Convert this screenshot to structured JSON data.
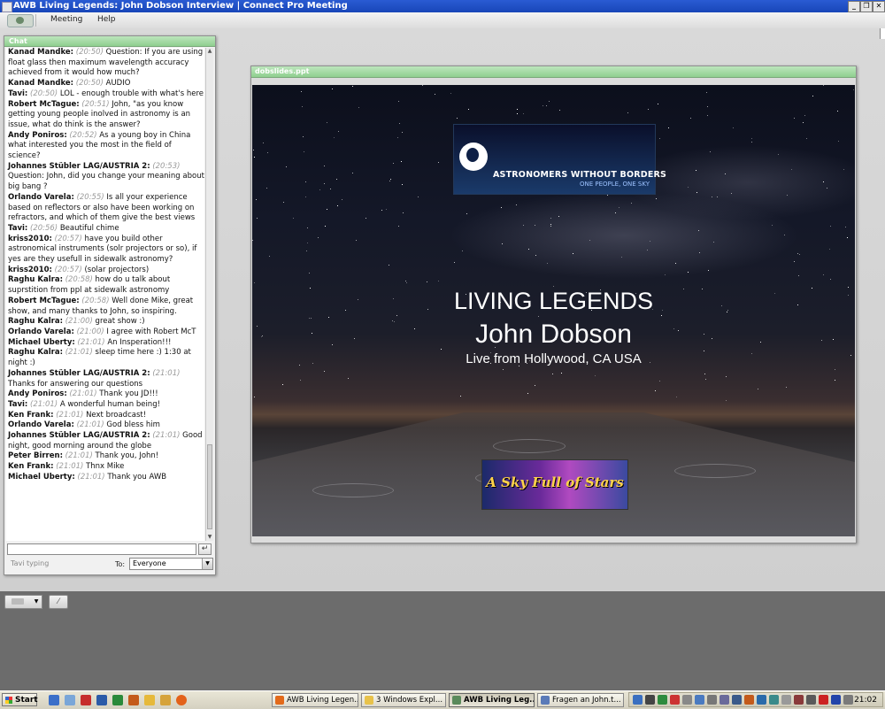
{
  "window": {
    "title": "AWB Living Legends: John Dobson Interview | Connect Pro Meeting",
    "controls": [
      "_",
      "❐",
      "✕"
    ]
  },
  "menu": {
    "items": [
      "Meeting",
      "Help"
    ]
  },
  "chat": {
    "pod_title": "Chat",
    "messages": [
      {
        "name": "Kanad Mandke:",
        "time": "(20:50)",
        "text": "Question: If you are using float glass then maximum wavelength accuracy achieved from it would how much?"
      },
      {
        "name": "Kanad Mandke:",
        "time": "(20:50)",
        "text": "AUDIO"
      },
      {
        "name": "Tavi:",
        "time": "(20:50)",
        "text": "LOL - enough trouble with what's here"
      },
      {
        "name": "Robert McTague:",
        "time": "(20:51)",
        "text": "John, \"as you know getting young people inolved in astronomy is an issue,  what do think is the answer?"
      },
      {
        "name": "Andy Poniros:",
        "time": "(20:52)",
        "text": "As a young boy in China what interested you the most in the field of science?"
      },
      {
        "name": "Johannes Stübler LAG/AUSTRIA 2:",
        "time": "(20:53)",
        "text": "Question: John, did you change your meaning about big bang ?"
      },
      {
        "name": "Orlando Varela:",
        "time": "(20:55)",
        "text": "Is all your experience based on reflectors or  also have been working on refractors, and which of them give the best views"
      },
      {
        "name": "Tavi:",
        "time": "(20:56)",
        "text": "Beautiful chime"
      },
      {
        "name": "kriss2010:",
        "time": "(20:57)",
        "text": "have you build other astronomical instruments (solr projectors or so), if yes are they usefull in sidewalk astronomy?"
      },
      {
        "name": "kriss2010:",
        "time": "(20:57)",
        "text": "(solar projectors)"
      },
      {
        "name": "Raghu Kalra:",
        "time": "(20:58)",
        "text": "how do u talk about suprstition from ppl at sidewalk astronomy"
      },
      {
        "name": "Robert McTague:",
        "time": "(20:58)",
        "text": "Well done Mike, great show,  and many thanks to John,  so inspiring."
      },
      {
        "name": "Raghu Kalra:",
        "time": "(21:00)",
        "text": "great show :)"
      },
      {
        "name": "Orlando Varela:",
        "time": "(21:00)",
        "text": "I agree with Robert McT"
      },
      {
        "name": "Michael Uberty:",
        "time": "(21:01)",
        "text": "An Insperation!!!"
      },
      {
        "name": "Raghu Kalra:",
        "time": "(21:01)",
        "text": "sleep time here :) 1:30 at night :)"
      },
      {
        "name": "Johannes Stübler LAG/AUSTRIA 2:",
        "time": "(21:01)",
        "text": "Thanks for answering our questions"
      },
      {
        "name": "Andy Poniros:",
        "time": "(21:01)",
        "text": "Thank you JD!!!"
      },
      {
        "name": "Tavi:",
        "time": "(21:01)",
        "text": "A wonderful human being!"
      },
      {
        "name": "Ken Frank:",
        "time": "(21:01)",
        "text": "Next broadcast!"
      },
      {
        "name": "Orlando Varela:",
        "time": "(21:01)",
        "text": "God bless him"
      },
      {
        "name": "Johannes Stübler LAG/AUSTRIA 2:",
        "time": "(21:01)",
        "text": "Good night, good morning around the globe"
      },
      {
        "name": "Peter Birren:",
        "time": "(21:01)",
        "text": "Thank you, John!"
      },
      {
        "name": "Ken Frank:",
        "time": "(21:01)",
        "text": "Thnx Mike"
      },
      {
        "name": "Michael Uberty:",
        "time": "(21:01)",
        "text": "Thank you AWB"
      }
    ],
    "input_value": "",
    "send_icon": "enter-arrow-icon",
    "typing_status": "Tavi typing",
    "to_label": "To:",
    "to_value": "Everyone"
  },
  "slides": {
    "pod_title": "dobslides.ppt",
    "logo_name": "ASTRONOMERS WITHOUT BORDERS",
    "logo_tagline": "ONE PEOPLE, ONE SKY",
    "title": "LIVING LEGENDS",
    "name": "John Dobson",
    "subtitle": "Live from Hollywood, CA USA",
    "banner": "A Sky Full of Stars"
  },
  "taskbar": {
    "start": "Start",
    "tasks": [
      {
        "label": "AWB Living Legen...",
        "icon_color": "#e36a1a"
      },
      {
        "label": "3 Windows Expl...",
        "icon_color": "#e8c24a"
      },
      {
        "label": "AWB Living Leg...",
        "icon_color": "#5a8a5a",
        "active": true
      },
      {
        "label": "Fragen an John.t...",
        "icon_color": "#5a7ab8"
      }
    ],
    "clock": "21:02"
  }
}
